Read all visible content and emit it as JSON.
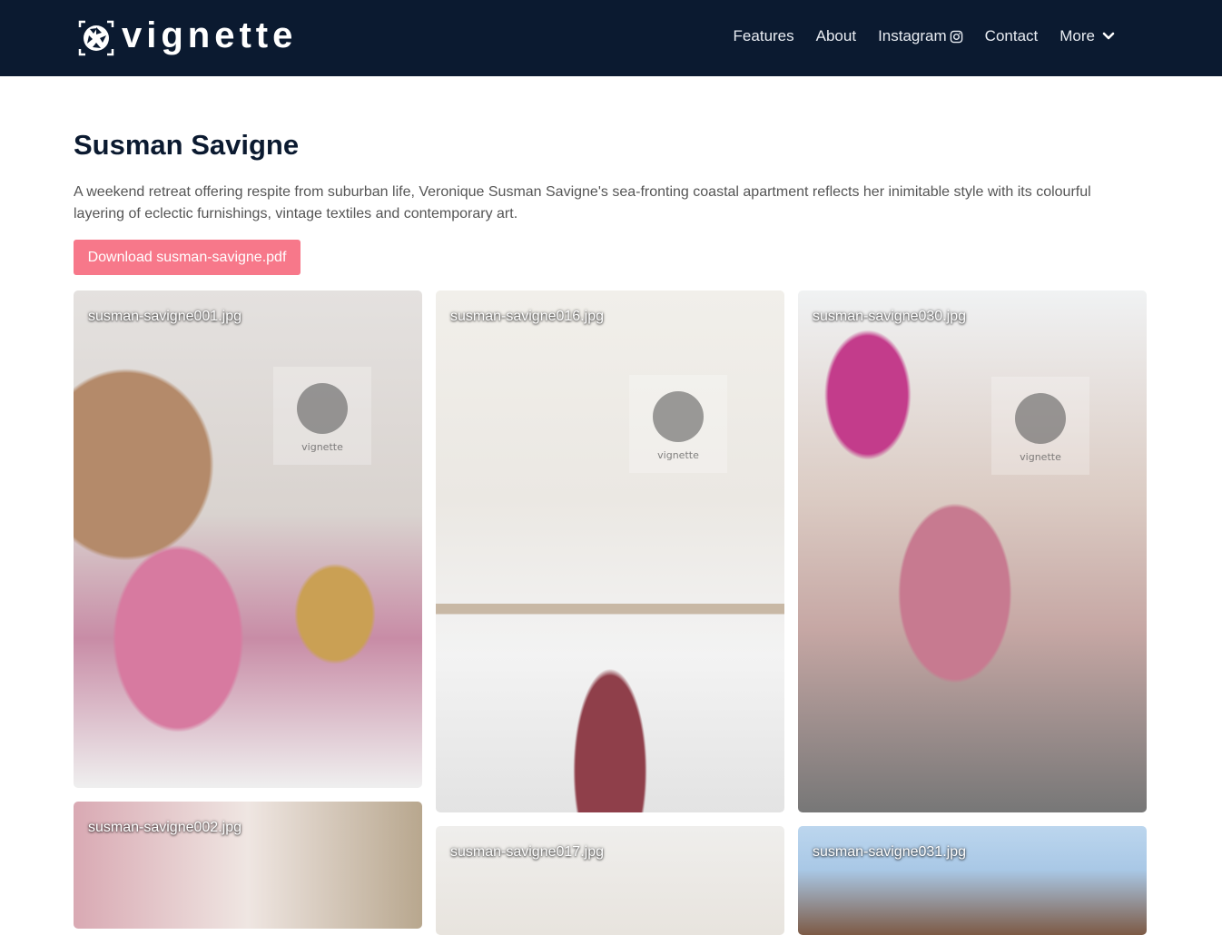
{
  "brand": {
    "name": "vignette"
  },
  "nav": {
    "items": [
      {
        "label": "Features"
      },
      {
        "label": "About"
      },
      {
        "label": "Instagram"
      },
      {
        "label": "Contact"
      },
      {
        "label": "More"
      }
    ]
  },
  "page": {
    "title": "Susman Savigne",
    "description": "A weekend retreat offering respite from suburban life, Veronique Susman Savigne's sea-fronting coastal apartment reflects her inimitable style with its colourful layering of eclectic furnishings, vintage textiles and contemporary art.",
    "download_label": "Download susman-savigne.pdf"
  },
  "gallery": [
    {
      "caption": "susman-savigne001.jpg"
    },
    {
      "caption": "susman-savigne016.jpg"
    },
    {
      "caption": "susman-savigne030.jpg"
    },
    {
      "caption": "susman-savigne002.jpg"
    },
    {
      "caption": "susman-savigne017.jpg"
    },
    {
      "caption": "susman-savigne031.jpg"
    }
  ],
  "watermark": {
    "text": "vignette"
  },
  "colors": {
    "navbar": "#0b1a30",
    "accent": "#f7788a",
    "title": "#0b1a30"
  }
}
